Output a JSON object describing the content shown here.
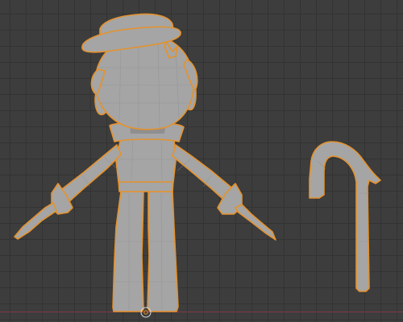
{
  "viewport": {
    "background": "#3d3d3d",
    "grid_color": "#333333",
    "x_axis_color": "#8b3a45",
    "mesh_color": "#a5a5a5",
    "selection_outline_color": "#e5922c"
  },
  "scene": {
    "objects": [
      {
        "name": "character",
        "icon": "character-mesh",
        "selected": true
      },
      {
        "name": "cane",
        "icon": "cane-mesh",
        "selected": true
      }
    ],
    "origin_marker": {
      "icon": "3d-cursor-icon"
    }
  }
}
